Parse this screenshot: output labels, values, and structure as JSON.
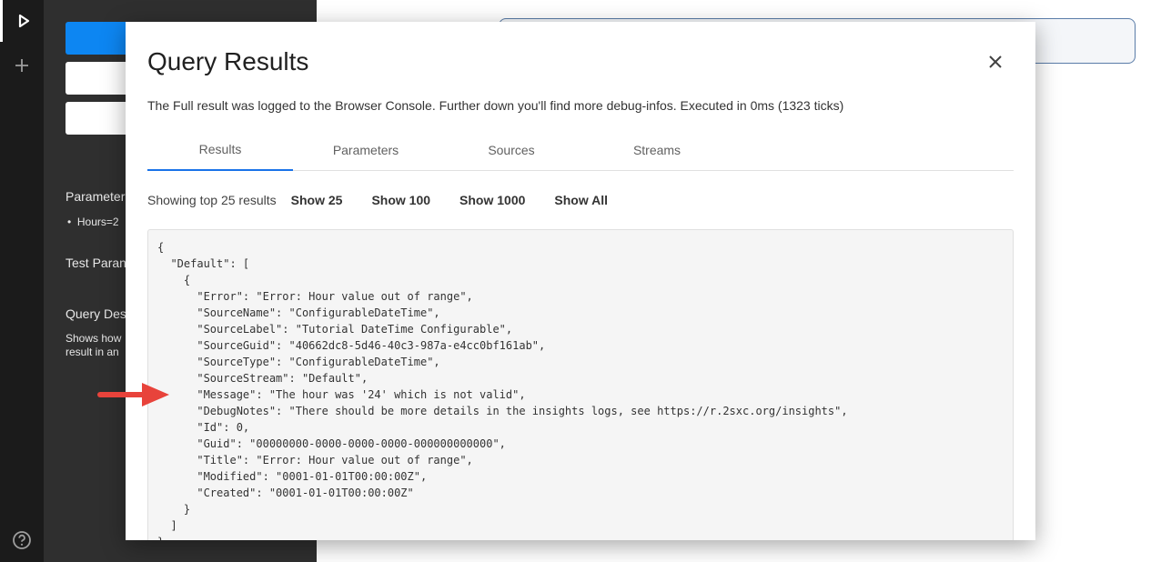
{
  "rail": {
    "icons": [
      "play-icon",
      "add-icon",
      "help-icon"
    ]
  },
  "panel": {
    "parameters_label": "Parameter",
    "hours_item": "Hours=2",
    "test_params_label": "Test Paran",
    "query_desc_label": "Query Desc",
    "desc_line1": "Shows how",
    "desc_line2": "result in an"
  },
  "dialog": {
    "title": "Query Results",
    "subtitle": "The Full result was logged to the Browser Console. Further down you'll find more debug-infos. Executed in 0ms (1323 ticks)",
    "tabs": [
      {
        "label": "Results",
        "active": true
      },
      {
        "label": "Parameters",
        "active": false
      },
      {
        "label": "Sources",
        "active": false
      },
      {
        "label": "Streams",
        "active": false
      }
    ],
    "showing_text": "Showing top 25 results",
    "show_buttons": [
      "Show 25",
      "Show 100",
      "Show 1000",
      "Show All"
    ],
    "json_lines": [
      "{",
      "  \"Default\": [",
      "    {",
      "      \"Error\": \"Error: Hour value out of range\",",
      "      \"SourceName\": \"ConfigurableDateTime\",",
      "      \"SourceLabel\": \"Tutorial DateTime Configurable\",",
      "      \"SourceGuid\": \"40662dc8-5d46-40c3-987a-e4cc0bf161ab\",",
      "      \"SourceType\": \"ConfigurableDateTime\",",
      "      \"SourceStream\": \"Default\",",
      "      \"Message\": \"The hour was '24' which is not valid\",",
      "      \"DebugNotes\": \"There should be more details in the insights logs, see https://r.2sxc.org/insights\",",
      "      \"Id\": 0,",
      "      \"Guid\": \"00000000-0000-0000-0000-000000000000\",",
      "      \"Title\": \"Error: Hour value out of range\",",
      "      \"Modified\": \"0001-01-01T00:00:00Z\",",
      "      \"Created\": \"0001-01-01T00:00:00Z\"",
      "    }",
      "  ]",
      "}"
    ]
  },
  "colors": {
    "accent": "#0d86f2",
    "tab_underline": "#1a73e8",
    "arrow": "#e8433b",
    "rail_bg": "#1b1b1b",
    "panel_bg": "#2f2f2f"
  }
}
